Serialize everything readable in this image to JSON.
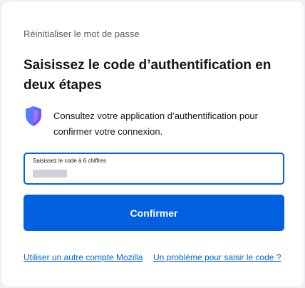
{
  "breadcrumb": "Réinitialiser le mot de passe",
  "heading": "Saisissez le code d’authentification en deux étapes",
  "instructions": {
    "icon": "shield-icon",
    "text": "Consultez votre application d’authentification pour confirmer votre connexion."
  },
  "code_field": {
    "label": "Saisissez le code à 6 chiffres",
    "value": ""
  },
  "confirm_button": "Confirmer",
  "links": {
    "other_account": "Utiliser un autre compte Mozilla",
    "problem": "Un problème pour saisir le code ?"
  },
  "colors": {
    "accent": "#0060df",
    "shield_blue": "#3b7bff",
    "shield_purple": "#8f3ef5"
  }
}
